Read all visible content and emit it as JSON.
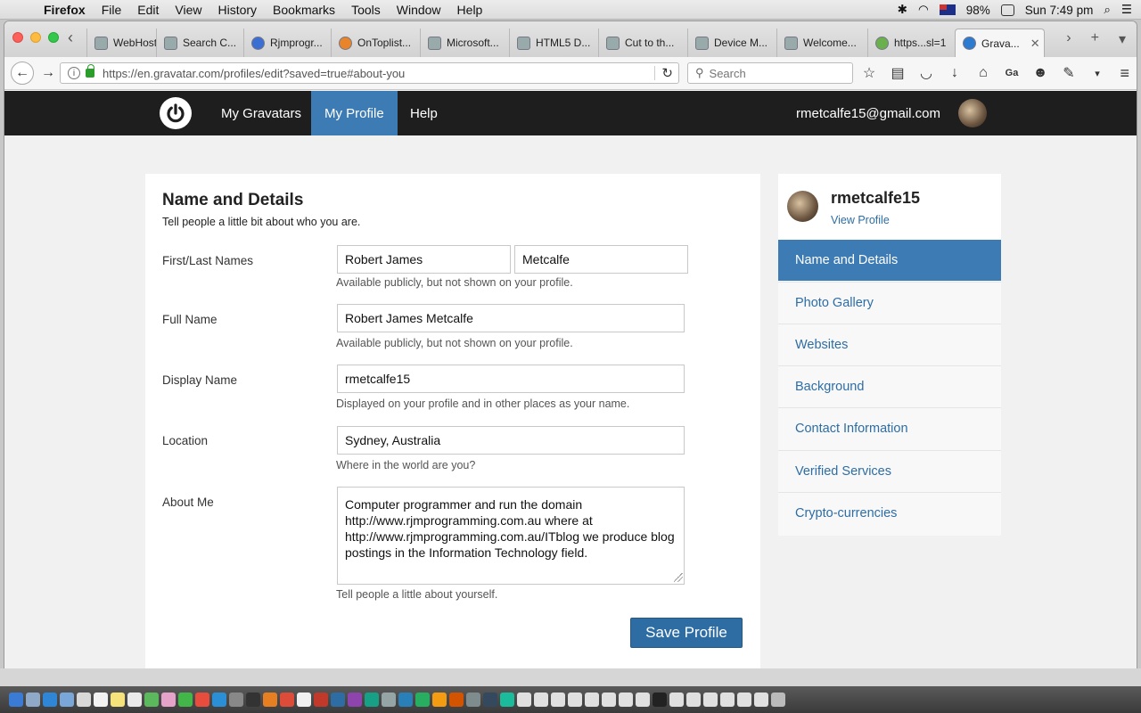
{
  "menubar": {
    "app": "Firefox",
    "items": [
      "File",
      "Edit",
      "View",
      "History",
      "Bookmarks",
      "Tools",
      "Window",
      "Help"
    ],
    "battery": "98%",
    "clock": "Sun 7:49 pm"
  },
  "tabs": [
    {
      "label": "WebHost..."
    },
    {
      "label": "Search C..."
    },
    {
      "label": "Rjmprogr..."
    },
    {
      "label": "OnToplist..."
    },
    {
      "label": "Microsoft..."
    },
    {
      "label": "HTML5 D..."
    },
    {
      "label": "Cut to th..."
    },
    {
      "label": "Device M..."
    },
    {
      "label": "Welcome..."
    },
    {
      "label": "https...sl=1"
    },
    {
      "label": "Grava..."
    }
  ],
  "browser": {
    "url": "https://en.gravatar.com/profiles/edit?saved=true#about-you",
    "search_placeholder": "Search",
    "toolbar_extra": "Ga"
  },
  "site": {
    "nav": [
      "My Gravatars",
      "My Profile",
      "Help"
    ],
    "active_nav": "My Profile",
    "user_email": "rmetcalfe15@gmail.com"
  },
  "form": {
    "title": "Name and Details",
    "subtitle": "Tell people a little bit about who you are.",
    "first_last_label": "First/Last Names",
    "first_name": "Robert James",
    "last_name": "Metcalfe",
    "first_last_hint": "Available publicly, but not shown on your profile.",
    "full_name_label": "Full Name",
    "full_name": "Robert James Metcalfe",
    "full_name_hint": "Available publicly, but not shown on your profile.",
    "display_name_label": "Display Name",
    "display_name": "rmetcalfe15",
    "display_name_hint": "Displayed on your profile and in other places as your name.",
    "location_label": "Location",
    "location": "Sydney, Australia",
    "location_hint": "Where in the world are you?",
    "about_label": "About Me",
    "about": "Computer programmer and run the domain http://www.rjmprogramming.com.au where at http://www.rjmprogramming.com.au/ITblog we produce blog postings in the Information Technology field.",
    "about_hint": "Tell people a little about yourself.",
    "save_label": "Save Profile"
  },
  "sidebar": {
    "username": "rmetcalfe15",
    "view_profile": "View Profile",
    "items": [
      {
        "label": "Name and Details",
        "active": true
      },
      {
        "label": "Photo Gallery"
      },
      {
        "label": "Websites"
      },
      {
        "label": "Background"
      },
      {
        "label": "Contact Information"
      },
      {
        "label": "Verified Services"
      },
      {
        "label": "Crypto-currencies"
      }
    ]
  },
  "colors": {
    "accent": "#3d7bb5",
    "header_bg": "#1e1e1e",
    "button": "#2d6da4"
  }
}
